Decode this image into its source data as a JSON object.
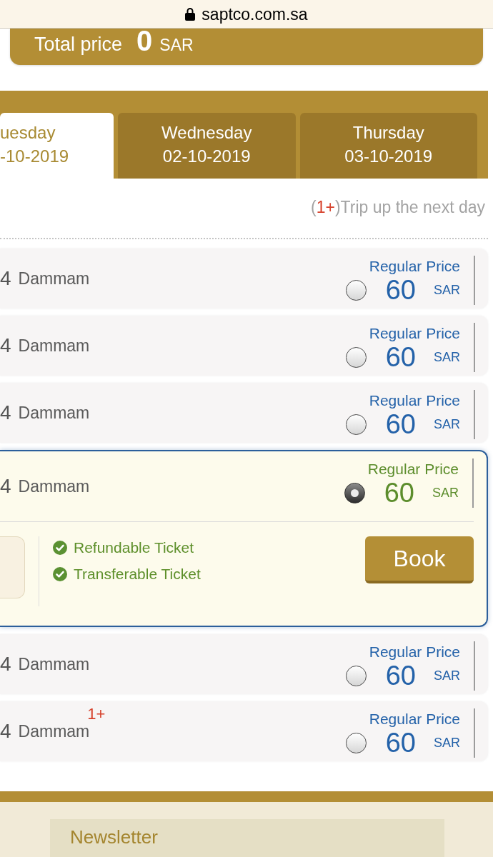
{
  "address_bar": {
    "url": "saptco.com.sa"
  },
  "total_price": {
    "label": "Total price",
    "amount": "0",
    "currency": "SAR"
  },
  "date_tabs": [
    {
      "day": "uesday",
      "date": "-10-2019",
      "selected": true
    },
    {
      "day": "Wednesday",
      "date": "02-10-2019",
      "selected": false
    },
    {
      "day": "Thursday",
      "date": "03-10-2019",
      "selected": false
    }
  ],
  "next_day_note": {
    "open": "(",
    "mark": "1+",
    "text": ")Trip up the next day"
  },
  "trips": [
    {
      "column_1": "4",
      "city": "Dammam",
      "price_label": "Regular Price",
      "price": "60",
      "currency": "SAR",
      "selected": false
    },
    {
      "column_1": "4",
      "city": "Dammam",
      "price_label": "Regular Price",
      "price": "60",
      "currency": "SAR",
      "selected": false
    },
    {
      "column_1": "4",
      "city": "Dammam",
      "price_label": "Regular Price",
      "price": "60",
      "currency": "SAR",
      "selected": false
    },
    {
      "column_1": "4",
      "city": "Dammam",
      "price_label": "Regular Price",
      "price": "60",
      "currency": "SAR",
      "selected": true,
      "details": {
        "features": [
          "Refundable Ticket",
          "Transferable Ticket"
        ],
        "button": "Book"
      }
    },
    {
      "column_1": "4",
      "city": "Dammam",
      "price_label": "Regular Price",
      "price": "60",
      "currency": "SAR",
      "selected": false
    },
    {
      "column_1": "4",
      "city": "Dammam",
      "badge": "1+",
      "price_label": "Regular Price",
      "price": "60",
      "currency": "SAR",
      "selected": false
    }
  ],
  "footer": {
    "heading": "Newsletter"
  }
}
